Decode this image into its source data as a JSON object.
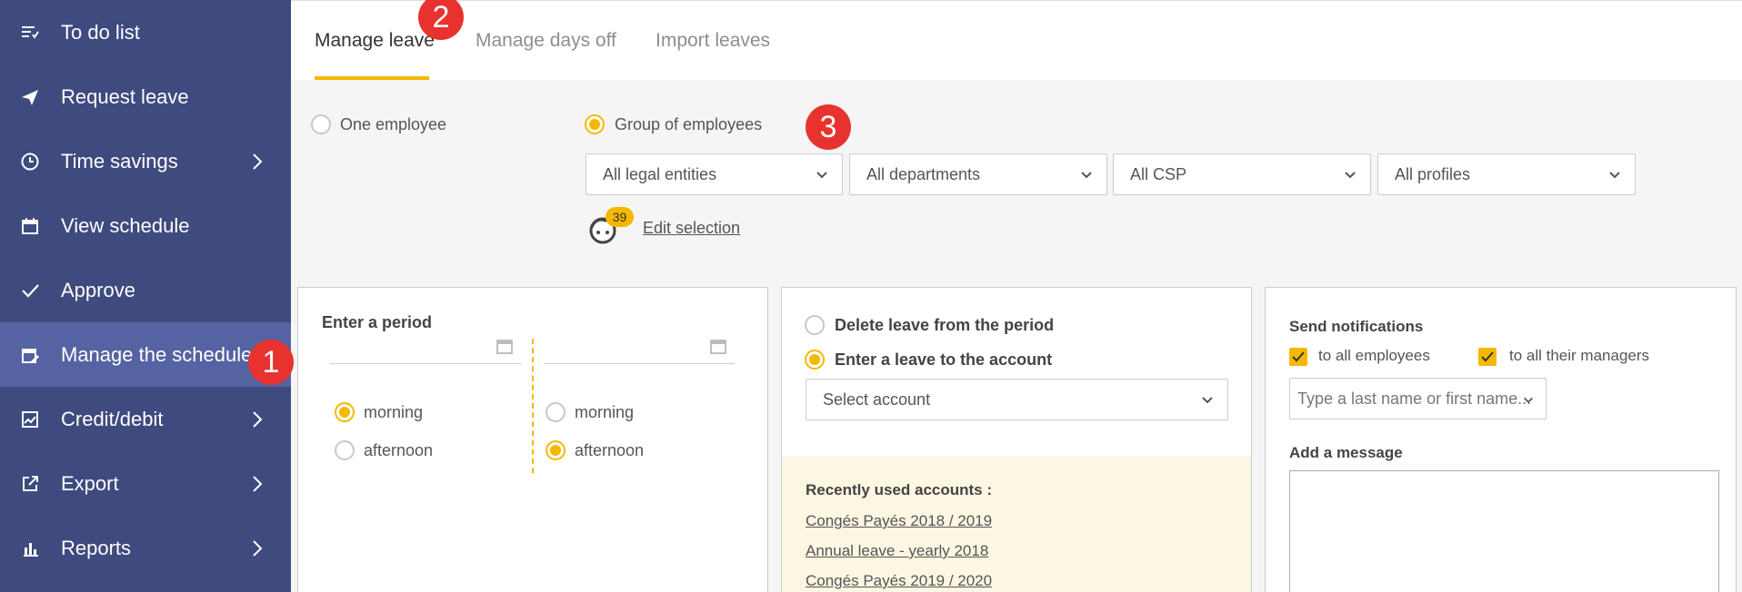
{
  "sidebar": {
    "items": [
      {
        "label": "To do list",
        "icon": "list-icon"
      },
      {
        "label": "Request leave",
        "icon": "send-icon"
      },
      {
        "label": "Time savings",
        "icon": "clock-icon"
      },
      {
        "label": "View schedule",
        "icon": "calendar-icon"
      },
      {
        "label": "Approve",
        "icon": "check-icon"
      },
      {
        "label": "Manage the schedule",
        "icon": "calendar-edit-icon"
      },
      {
        "label": "Credit/debit",
        "icon": "chart-box-icon"
      },
      {
        "label": "Export",
        "icon": "external-link-icon"
      },
      {
        "label": "Reports",
        "icon": "bar-chart-icon"
      }
    ]
  },
  "tabs": [
    "Manage leave",
    "Manage days off",
    "Import leaves"
  ],
  "callouts": [
    "1",
    "2",
    "3"
  ],
  "target": {
    "one_employee": "One employee",
    "group": "Group of employees",
    "filters": [
      "All legal entities",
      "All departments",
      "All CSP",
      "All profiles"
    ],
    "count": "39",
    "edit_selection": "Edit selection"
  },
  "period": {
    "title": "Enter a period",
    "start_morning": "morning",
    "start_afternoon": "afternoon",
    "end_morning": "morning",
    "end_afternoon": "afternoon"
  },
  "leave": {
    "delete_label": "Delete leave from the period",
    "enter_label": "Enter a leave to the account",
    "select_account": "Select account",
    "recent_title": "Recently used accounts :",
    "recent": [
      "Congés Payés 2018 / 2019",
      "Annual leave - yearly 2018",
      "Congés Payés 2019 / 2020"
    ]
  },
  "notify": {
    "title": "Send notifications",
    "all_employees": "to all employees",
    "all_managers": "to all their managers",
    "name_placeholder": "Type a last name or first name...",
    "message_label": "Add a message"
  },
  "colors": {
    "sidebar": "#3f4a7e",
    "active": "#5663a3",
    "accent": "#f5b800",
    "callout": "#e8322f"
  }
}
